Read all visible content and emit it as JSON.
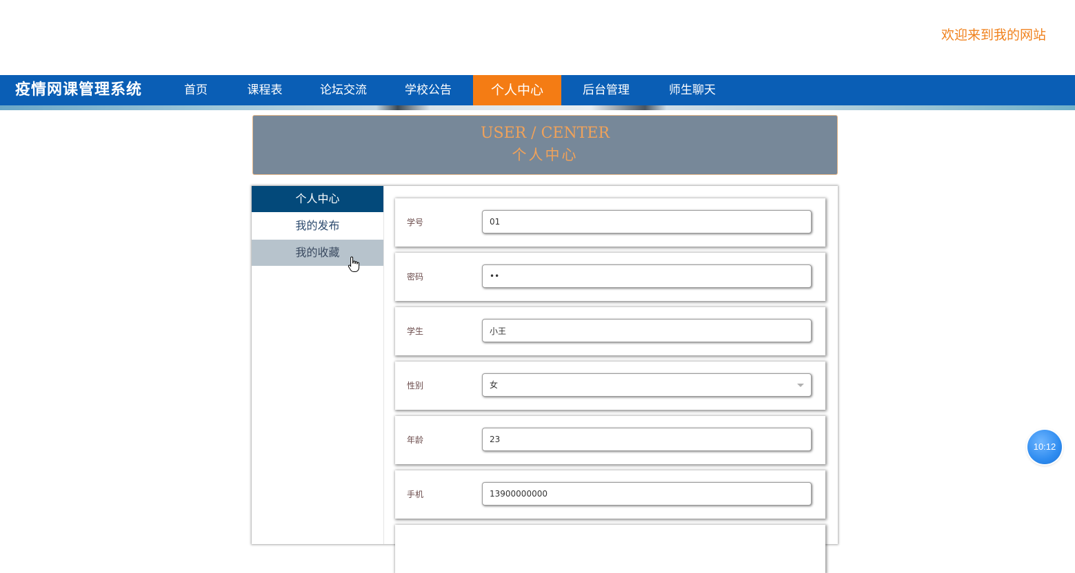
{
  "header": {
    "welcome_text": "欢迎来到我的网站"
  },
  "nav": {
    "brand": "疫情网课管理系统",
    "items": [
      {
        "label": "首页",
        "active": false
      },
      {
        "label": "课程表",
        "active": false
      },
      {
        "label": "论坛交流",
        "active": false
      },
      {
        "label": "学校公告",
        "active": false
      },
      {
        "label": "个人中心",
        "active": true
      },
      {
        "label": "后台管理",
        "active": false
      },
      {
        "label": "师生聊天",
        "active": false
      }
    ]
  },
  "banner": {
    "title_en": "USER / CENTER",
    "title_cn": "个人中心"
  },
  "sidebar": {
    "items": [
      {
        "label": "个人中心",
        "state": "active"
      },
      {
        "label": "我的发布",
        "state": "normal"
      },
      {
        "label": "我的收藏",
        "state": "hover"
      }
    ]
  },
  "form": {
    "fields": [
      {
        "label": "学号",
        "value": "01",
        "type": "text"
      },
      {
        "label": "密码",
        "value": "••",
        "type": "password"
      },
      {
        "label": "学生",
        "value": "小王",
        "type": "text"
      },
      {
        "label": "性别",
        "value": "女",
        "type": "select"
      },
      {
        "label": "年龄",
        "value": "23",
        "type": "text"
      },
      {
        "label": "手机",
        "value": "13900000000",
        "type": "text"
      }
    ]
  },
  "clock_widget": {
    "time": "10:12"
  },
  "colors": {
    "nav_bg": "#0a5eb5",
    "nav_active": "#f47c14",
    "welcome": "#f0821e",
    "banner_bg": "#778899",
    "sidebar_active": "#03497a"
  }
}
